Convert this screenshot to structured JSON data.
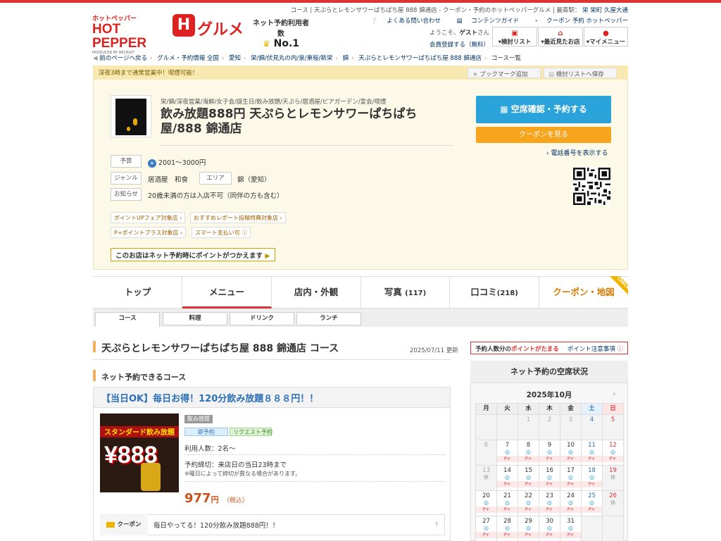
{
  "header": {
    "brand_small": "ホットペッパー",
    "brand_big": "HOT PEPPER",
    "brand_sub": "PRODUCED BY RECRUIT",
    "gourmet_icon": "H",
    "gourmet": "グルメ",
    "net_label": "ネット予約利用者数",
    "no1": "No.1",
    "top_breadcrumb": "コース | 天ぷらとレモンサワーぱちぱち屋 888 錦通店 - クーポン・予約のホットペッパーグルメ",
    "nearest_label": "| 最寄駅：",
    "nearest_stations": "栄 栄町 久屋大通",
    "links": [
      "よくある問い合わせ",
      "コンテンツガイド",
      "クーポン 予約 ホットペッパー"
    ],
    "welcome_prefix": "ようこそ、",
    "welcome_name": "ゲスト",
    "welcome_suffix": "さん",
    "register": "会員登録する（無料）",
    "nav": [
      {
        "label": "▾検討リスト"
      },
      {
        "label": "▾最近見たお店"
      },
      {
        "label": "▾マイメニュー"
      }
    ]
  },
  "breadcrumb": {
    "back": "前のページへ戻る",
    "items": [
      "グルメ・予約情報 全国",
      "愛知",
      "栄/錦/伏見丸の内/泉/東桜/新栄",
      "錦",
      "天ぷらとレモンサワーぱちぱち屋 888 錦通店"
    ],
    "current": "コース一覧"
  },
  "shop": {
    "notice": "深夜3時まで通常営業中！喫煙可能！",
    "bookmark": "ブックマーク追加",
    "save_list": "検討リストへ保存",
    "tags": "栄/錦/深夜営業/海鮮/女子会/誕生日/飲み放題/天ぷら/居酒屋/ビアガーデン/宴会/喫煙",
    "name": "飲み放題888円 天ぷらとレモンサワーぱちぱち屋/888 錦通店",
    "budget_label": "予算",
    "budget": "2001～3000円",
    "genre_label": "ジャンル",
    "genre": "居酒屋　和食",
    "area_label": "エリア",
    "area": "錦（愛知）",
    "info_label": "お知らせ",
    "info": "20歳未満の方は入店不可（同伴の方も含む）",
    "badges": [
      "ポイントUPフェア対象店",
      "おすすめレポート投稿特典対象店",
      "ポイントプラス対象店",
      "スマート支払い可"
    ],
    "point_banner": "このお店はネット予約時にポイントがつかえます",
    "reserve_btn": "空席確認・予約する",
    "coupon_btn": "クーポンを見る",
    "tel": "電話番号を表示する"
  },
  "tabs": [
    {
      "label": "トップ",
      "count": ""
    },
    {
      "label": "メニュー",
      "count": ""
    },
    {
      "label": "店内・外観",
      "count": ""
    },
    {
      "label": "写真",
      "count": "(117)"
    },
    {
      "label": "口コミ",
      "count": "(218)"
    },
    {
      "label": "クーポン・地図",
      "count": ""
    }
  ],
  "check_label": "CHECK",
  "subtabs": [
    "コース",
    "料理",
    "ドリンク",
    "ランチ"
  ],
  "main": {
    "title": "天ぷらとレモンサワーぱちぱち屋 888 錦通店 コース",
    "updated": "2025/07/11 更新",
    "section": "ネット予約できるコース",
    "course": {
      "title": "【当日OK】毎日お得！120分飲み放題８８８円！！",
      "img_banner": "スタンダード飲み放題",
      "img_price": "¥888",
      "category": "飲み放題",
      "pill_instant": "即予約",
      "pill_request": "リクエスト予約",
      "people": "利用人数：2名～",
      "deadline": "予約締切：来店日の当日23時まで",
      "deadline_note": "※曜日によって締切が異なる場合があります。",
      "price": "977",
      "price_unit": "円",
      "tax": "（税込）",
      "coupon_label": "クーポン",
      "coupon_text": "毎日やってる！120分飲み放題888円！！"
    }
  },
  "sidebar": {
    "notice_a": "予約人数分の",
    "notice_b": "ポイントがたまる",
    "notice_link": "ポイント注意事項",
    "cal_title": "ネット予約の空席状況",
    "month": "2025年10月",
    "weekdays": [
      "月",
      "火",
      "水",
      "木",
      "金",
      "土",
      "日"
    ],
    "weeks": [
      [
        {
          "d": ""
        },
        {
          "d": ""
        },
        {
          "d": "1",
          "off": true
        },
        {
          "d": "2",
          "off": true
        },
        {
          "d": "3",
          "off": true
        },
        {
          "d": "4",
          "off": true
        },
        {
          "d": "5",
          "off": true
        }
      ],
      [
        {
          "d": "6",
          "off": true
        },
        {
          "d": "7",
          "o": "◎",
          "p": "P+"
        },
        {
          "d": "8",
          "o": "◎",
          "p": "P+"
        },
        {
          "d": "9",
          "o": "◎",
          "p": "P+"
        },
        {
          "d": "10",
          "o": "◎",
          "p": "P+"
        },
        {
          "d": "11",
          "o": "◎",
          "p": "P+"
        },
        {
          "d": "12",
          "o": "◎",
          "p": "P+"
        }
      ],
      [
        {
          "d": "13",
          "off": true,
          "k": "休"
        },
        {
          "d": "14",
          "o": "◎",
          "p": "P+"
        },
        {
          "d": "15",
          "o": "◎",
          "p": "P+"
        },
        {
          "d": "16",
          "o": "◎",
          "p": "P+"
        },
        {
          "d": "17",
          "o": "◎",
          "p": "P+"
        },
        {
          "d": "18",
          "o": "◎",
          "p": "P+"
        },
        {
          "d": "19",
          "off": true,
          "k": "休"
        }
      ],
      [
        {
          "d": "20",
          "o": "◎",
          "p": "P+"
        },
        {
          "d": "21",
          "o": "◎",
          "p": "P+"
        },
        {
          "d": "22",
          "o": "◎",
          "p": "P+"
        },
        {
          "d": "23",
          "o": "◎",
          "p": "P+"
        },
        {
          "d": "24",
          "o": "◎",
          "p": "P+"
        },
        {
          "d": "25",
          "o": "◎",
          "p": "P+"
        },
        {
          "d": "26",
          "off": true,
          "k": "休"
        }
      ],
      [
        {
          "d": "27",
          "o": "◎",
          "p": "P+"
        },
        {
          "d": "28",
          "o": "◎",
          "p": "P+"
        },
        {
          "d": "29",
          "o": "◎",
          "p": "P+"
        },
        {
          "d": "30",
          "o": "◎",
          "p": "P+"
        },
        {
          "d": "31",
          "o": "◎",
          "p": "P+"
        },
        {
          "d": ""
        },
        {
          "d": ""
        }
      ]
    ]
  }
}
